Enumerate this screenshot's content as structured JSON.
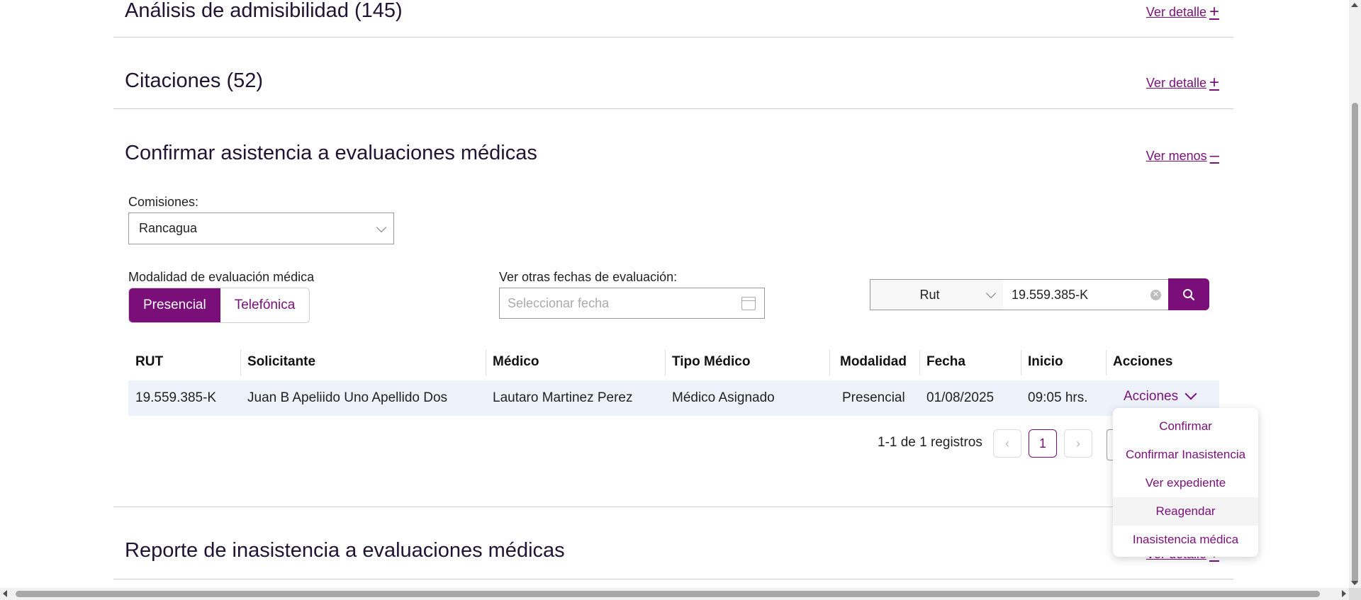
{
  "sections": {
    "admisibilidad": {
      "title": "Análisis de admisibilidad (145)",
      "link": "Ver detalle"
    },
    "citaciones": {
      "title": "Citaciones (52)",
      "link": "Ver detalle"
    },
    "confirmar": {
      "title": "Confirmar asistencia a evaluaciones médicas",
      "link": "Ver menos"
    },
    "reporte": {
      "title": "Reporte de inasistencia a evaluaciones médicas",
      "link": "Ver detalle"
    }
  },
  "filters": {
    "comisiones_label": "Comisiones:",
    "comisiones_value": "Rancagua",
    "modalidad_label": "Modalidad de evaluación médica",
    "modalidad_options": [
      "Presencial",
      "Telefónica"
    ],
    "modalidad_selected": "Presencial",
    "fechas_label": "Ver otras fechas de evaluación:",
    "fecha_placeholder": "Seleccionar fecha",
    "search_type": "Rut",
    "search_value": "19.559.385-K"
  },
  "table": {
    "headers": [
      "RUT",
      "Solicitante",
      "Médico",
      "Tipo Médico",
      "Modalidad",
      "Fecha",
      "Inicio",
      "Acciones"
    ],
    "rows": [
      {
        "rut": "19.559.385-K",
        "solicitante": "Juan B Apeliido Uno Apellido Dos",
        "medico": "Lautaro Martinez Perez",
        "tipo_medico": "Médico Asignado",
        "modalidad": "Presencial",
        "fecha": "01/08/2025",
        "inicio": "09:05 hrs.",
        "acciones": "Acciones"
      }
    ]
  },
  "pagination": {
    "summary": "1-1 de 1 registros",
    "prev": "‹",
    "current_page": "1",
    "next": "›"
  },
  "actions_menu": {
    "items": [
      "Confirmar",
      "Confirmar Inasistencia",
      "Ver expediente",
      "Reagendar",
      "Inasistencia médica"
    ],
    "hovered": "Reagendar"
  },
  "colors": {
    "accent": "#7a0f7a",
    "row_highlight": "#eef3fb",
    "title": "#1f1433"
  }
}
